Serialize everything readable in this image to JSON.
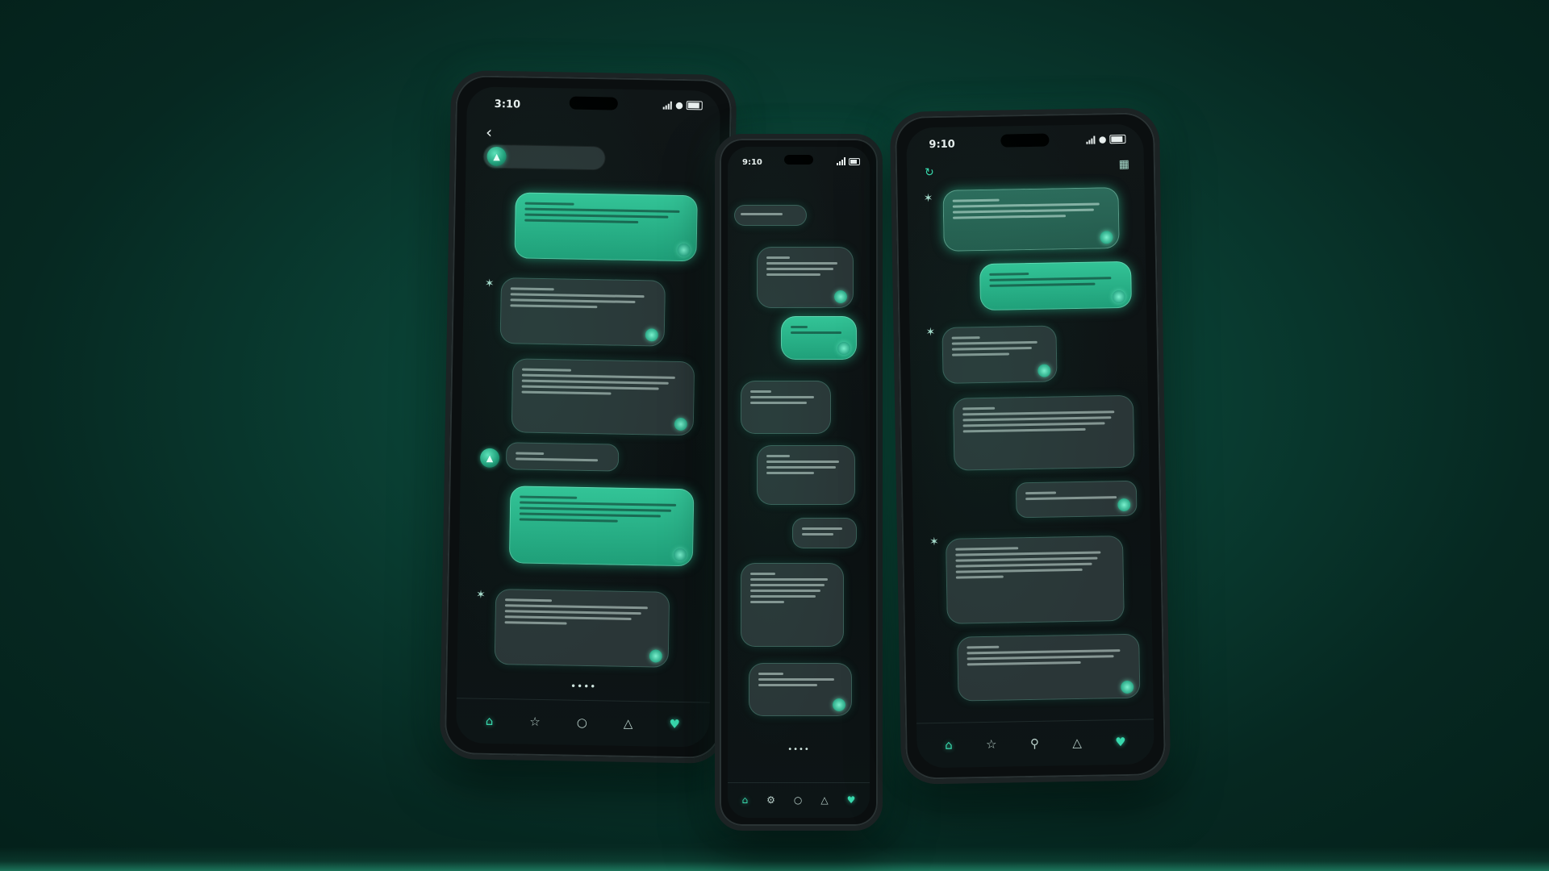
{
  "colors": {
    "background": "#0a4034",
    "accent_green": "#33c497",
    "bubble_dark": "#2a3637",
    "phone_body": "#0b0f10"
  },
  "phones": {
    "left": {
      "time": "3:10",
      "nav": [
        "home-icon",
        "star-icon",
        "circle-icon",
        "bell-icon",
        "heart-icon"
      ]
    },
    "middle": {
      "time": "9:10",
      "nav": [
        "home-icon",
        "gear-icon",
        "circle-icon",
        "bell-icon",
        "heart-icon"
      ]
    },
    "right": {
      "time": "9:10",
      "nav": [
        "home-icon",
        "star-icon",
        "search-icon",
        "bell-icon",
        "heart-icon"
      ]
    }
  }
}
